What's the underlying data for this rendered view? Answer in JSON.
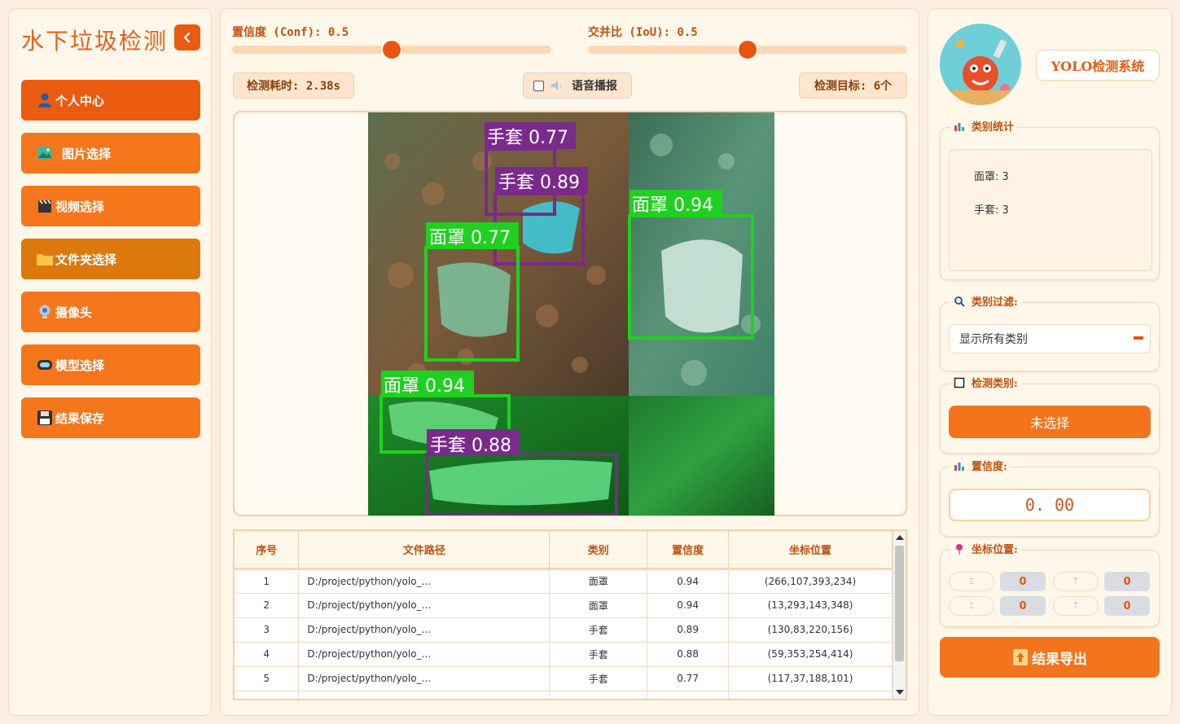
{
  "sidebar": {
    "title": "水下垃圾检测",
    "items": [
      {
        "label": "个人中心",
        "icon": "person-icon"
      },
      {
        "label": "图片选择",
        "icon": "image-icon"
      },
      {
        "label": "视频选择",
        "icon": "clapper-icon"
      },
      {
        "label": "文件夹选择",
        "icon": "folder-icon"
      },
      {
        "label": "摄像头",
        "icon": "camera-icon"
      },
      {
        "label": "模型选择",
        "icon": "model-icon"
      },
      {
        "label": "结果保存",
        "icon": "floppy-icon"
      }
    ]
  },
  "controls": {
    "conf_label": "置信度 (Conf): 0.5",
    "conf_value": 0.5,
    "iou_label": "交并比 (IoU): 0.5",
    "iou_value": 0.5,
    "time_label": "检测耗时: 2.38s",
    "voice_label": "语音播报",
    "targets_label": "检测目标: 6个"
  },
  "detections_overlay": [
    {
      "label": "手套 0.77"
    },
    {
      "label": "手套 0.89"
    },
    {
      "label": "面罩 0.94"
    },
    {
      "label": "面罩 0.77"
    },
    {
      "label": "面罩 0.94"
    },
    {
      "label": "手套 0.88"
    }
  ],
  "table": {
    "headers": [
      "序号",
      "文件路径",
      "类别",
      "置信度",
      "坐标位置"
    ],
    "rows": [
      {
        "idx": "1",
        "path": "D:/project/python/yolo_...",
        "cls": "面罩",
        "conf": "0.94",
        "box": "(266,107,393,234)"
      },
      {
        "idx": "2",
        "path": "D:/project/python/yolo_...",
        "cls": "面罩",
        "conf": "0.94",
        "box": "(13,293,143,348)"
      },
      {
        "idx": "3",
        "path": "D:/project/python/yolo_...",
        "cls": "手套",
        "conf": "0.89",
        "box": "(130,83,220,156)"
      },
      {
        "idx": "4",
        "path": "D:/project/python/yolo_...",
        "cls": "手套",
        "conf": "0.88",
        "box": "(59,353,254,414)"
      },
      {
        "idx": "5",
        "path": "D:/project/python/yolo_...",
        "cls": "手套",
        "conf": "0.77",
        "box": "(117,37,188,101)"
      }
    ]
  },
  "right": {
    "system_title": "YOLO检测系统",
    "stats_label": "类别统计",
    "stats": [
      "面罩: 3",
      "手套: 3"
    ],
    "filter_label": "类别过滤:",
    "filter_value": "显示所有类别",
    "detect_class_label": "检测类别:",
    "detect_class_value": "未选择",
    "conf_label": "置信度:",
    "conf_value": "0. 00",
    "coord_label": "坐标位置:",
    "coords": {
      "xmin": "0",
      "ymin": "0",
      "xmax": "0",
      "ymax": "0"
    },
    "export_label": "结果导出"
  },
  "colors": {
    "accent": "#f3741c",
    "accent_dark": "#ea5b12",
    "panel": "#fff8ea",
    "border": "#f2d9bf",
    "box_green": "#20e020",
    "box_purple": "#7a2a8a"
  }
}
